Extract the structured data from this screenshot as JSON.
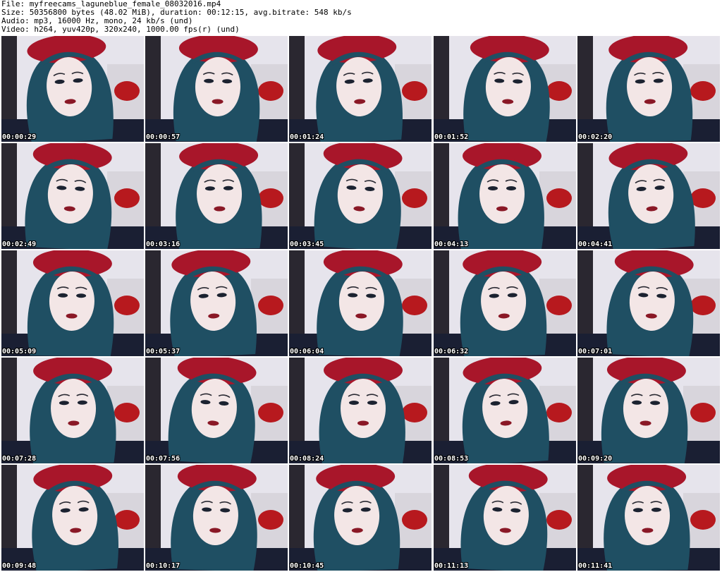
{
  "header": {
    "file_line": "File: myfreecams_laguneblue_female_08032016.mp4",
    "size_line": "Size: 50356800 bytes (48.02 MiB), duration: 00:12:15, avg.bitrate: 548 kb/s",
    "audio_line": "Audio: mp3, 16000 Hz, mono, 24 kb/s (und)",
    "video_line": "Video: h264, yuv420p, 320x240, 1000.00 fps(r) (und)"
  },
  "colors": {
    "hat": "#a8162a",
    "hair": "#1f4f63",
    "skin": "#f3e6e6",
    "shirt": "#1a1f33",
    "wall": "#e6e4ec",
    "bed": "#d8d5dc",
    "pillow": "#b7191e",
    "text": "#000000"
  },
  "thumbnails": [
    {
      "timestamp": "00:00:29"
    },
    {
      "timestamp": "00:00:57"
    },
    {
      "timestamp": "00:01:24"
    },
    {
      "timestamp": "00:01:52"
    },
    {
      "timestamp": "00:02:20"
    },
    {
      "timestamp": "00:02:49"
    },
    {
      "timestamp": "00:03:16"
    },
    {
      "timestamp": "00:03:45"
    },
    {
      "timestamp": "00:04:13"
    },
    {
      "timestamp": "00:04:41"
    },
    {
      "timestamp": "00:05:09"
    },
    {
      "timestamp": "00:05:37"
    },
    {
      "timestamp": "00:06:04"
    },
    {
      "timestamp": "00:06:32"
    },
    {
      "timestamp": "00:07:01"
    },
    {
      "timestamp": "00:07:28"
    },
    {
      "timestamp": "00:07:56"
    },
    {
      "timestamp": "00:08:24"
    },
    {
      "timestamp": "00:08:53"
    },
    {
      "timestamp": "00:09:20"
    },
    {
      "timestamp": "00:09:48"
    },
    {
      "timestamp": "00:10:17"
    },
    {
      "timestamp": "00:10:45"
    },
    {
      "timestamp": "00:11:13"
    },
    {
      "timestamp": "00:11:41"
    }
  ]
}
